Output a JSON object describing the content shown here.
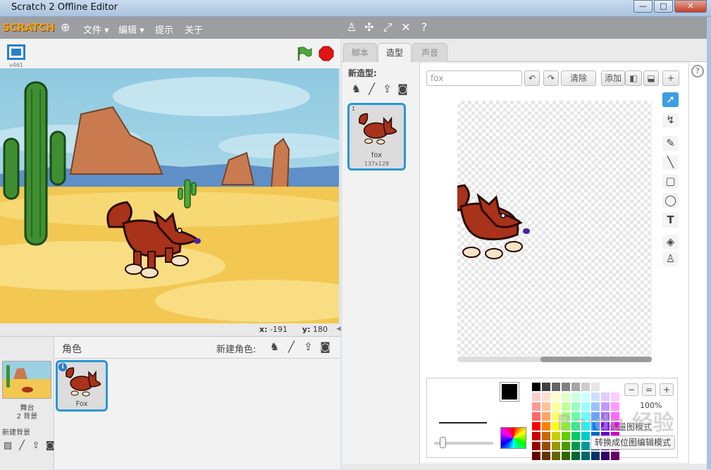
{
  "window": {
    "title": "Scratch 2 Offline Editor",
    "minimize": "—",
    "maximize": "□",
    "close": "✕"
  },
  "menubar": {
    "logo": "SCRATCH",
    "items": [
      "文件 ▾",
      "编辑 ▾",
      "提示",
      "关于"
    ],
    "tool_icons": [
      "stamp-icon",
      "cut-icon",
      "grow-icon",
      "shrink-icon",
      "help-icon"
    ]
  },
  "stage": {
    "version": "v461",
    "coord_x_label": "x:",
    "coord_x": "-191",
    "coord_y_label": "y:",
    "coord_y": "180"
  },
  "sprites": {
    "title": "角色",
    "new_sprite_label": "新建角色:",
    "stage_name": "舞台",
    "stage_backdrops": "2 背景",
    "new_backdrop_label": "新建背景",
    "items": [
      {
        "name": "Fox",
        "info": "i"
      }
    ]
  },
  "tabs": [
    {
      "label": "脚本",
      "active": false
    },
    {
      "label": "造型",
      "active": true
    },
    {
      "label": "声音",
      "active": false
    }
  ],
  "costumes": {
    "new_costume_label": "新造型:",
    "items": [
      {
        "number": "1",
        "name": "fox",
        "size": "137x128"
      }
    ]
  },
  "editor": {
    "name_value": "fox",
    "clear_label": "清除",
    "add_label": "添加",
    "zoom_level": "100%",
    "mode_text": "矢量图模式",
    "convert_label": "转换成位图编辑模式",
    "help": "?"
  },
  "palette_colors": [
    "#000000",
    "#404040",
    "#666666",
    "#808080",
    "#a6a6a6",
    "#cccccc",
    "#e6e6e6",
    "#ffffff",
    "#ffffff",
    "#ffcccc",
    "#ffe0cc",
    "#ffffcc",
    "#e0ffcc",
    "#ccffe0",
    "#ccffff",
    "#cce0ff",
    "#e0ccff",
    "#ffccff",
    "#ff9999",
    "#ffc299",
    "#ffff99",
    "#c2ff99",
    "#99ffc2",
    "#99ffff",
    "#99c2ff",
    "#c299ff",
    "#ff99ff",
    "#ff6666",
    "#ffa366",
    "#ffff66",
    "#a3ff66",
    "#66ffa3",
    "#66ffff",
    "#66a3ff",
    "#a366ff",
    "#ff66ff",
    "#ff0000",
    "#ff8000",
    "#ffff00",
    "#80ff00",
    "#00ff80",
    "#00ffff",
    "#0080ff",
    "#8000ff",
    "#ff00ff",
    "#cc0000",
    "#cc6600",
    "#cccc00",
    "#66cc00",
    "#00cc66",
    "#00cccc",
    "#0066cc",
    "#6600cc",
    "#cc00cc",
    "#990000",
    "#994c00",
    "#999900",
    "#4c9900",
    "#00994c",
    "#009999",
    "#004c99",
    "#4c0099",
    "#990099",
    "#660000",
    "#663300",
    "#666600",
    "#336600",
    "#006633",
    "#006666",
    "#003366",
    "#330066",
    "#660066"
  ],
  "watermark": "Baidu 经验"
}
